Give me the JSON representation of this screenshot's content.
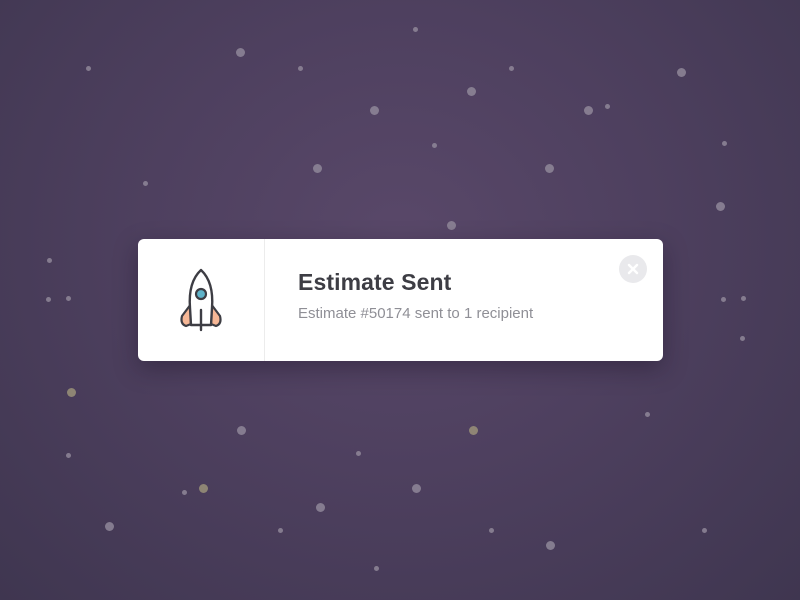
{
  "toast": {
    "title": "Estimate Sent",
    "message": "Estimate #50174 sent to 1 recipient",
    "icon": "rocket-icon",
    "close_icon": "close-icon"
  },
  "colors": {
    "background": "#4e405f",
    "card": "#ffffff",
    "title_text": "#3d3d44",
    "message_text": "#8f8f96",
    "rocket_accent": "#f6b796",
    "rocket_window": "#5fb3c9"
  }
}
